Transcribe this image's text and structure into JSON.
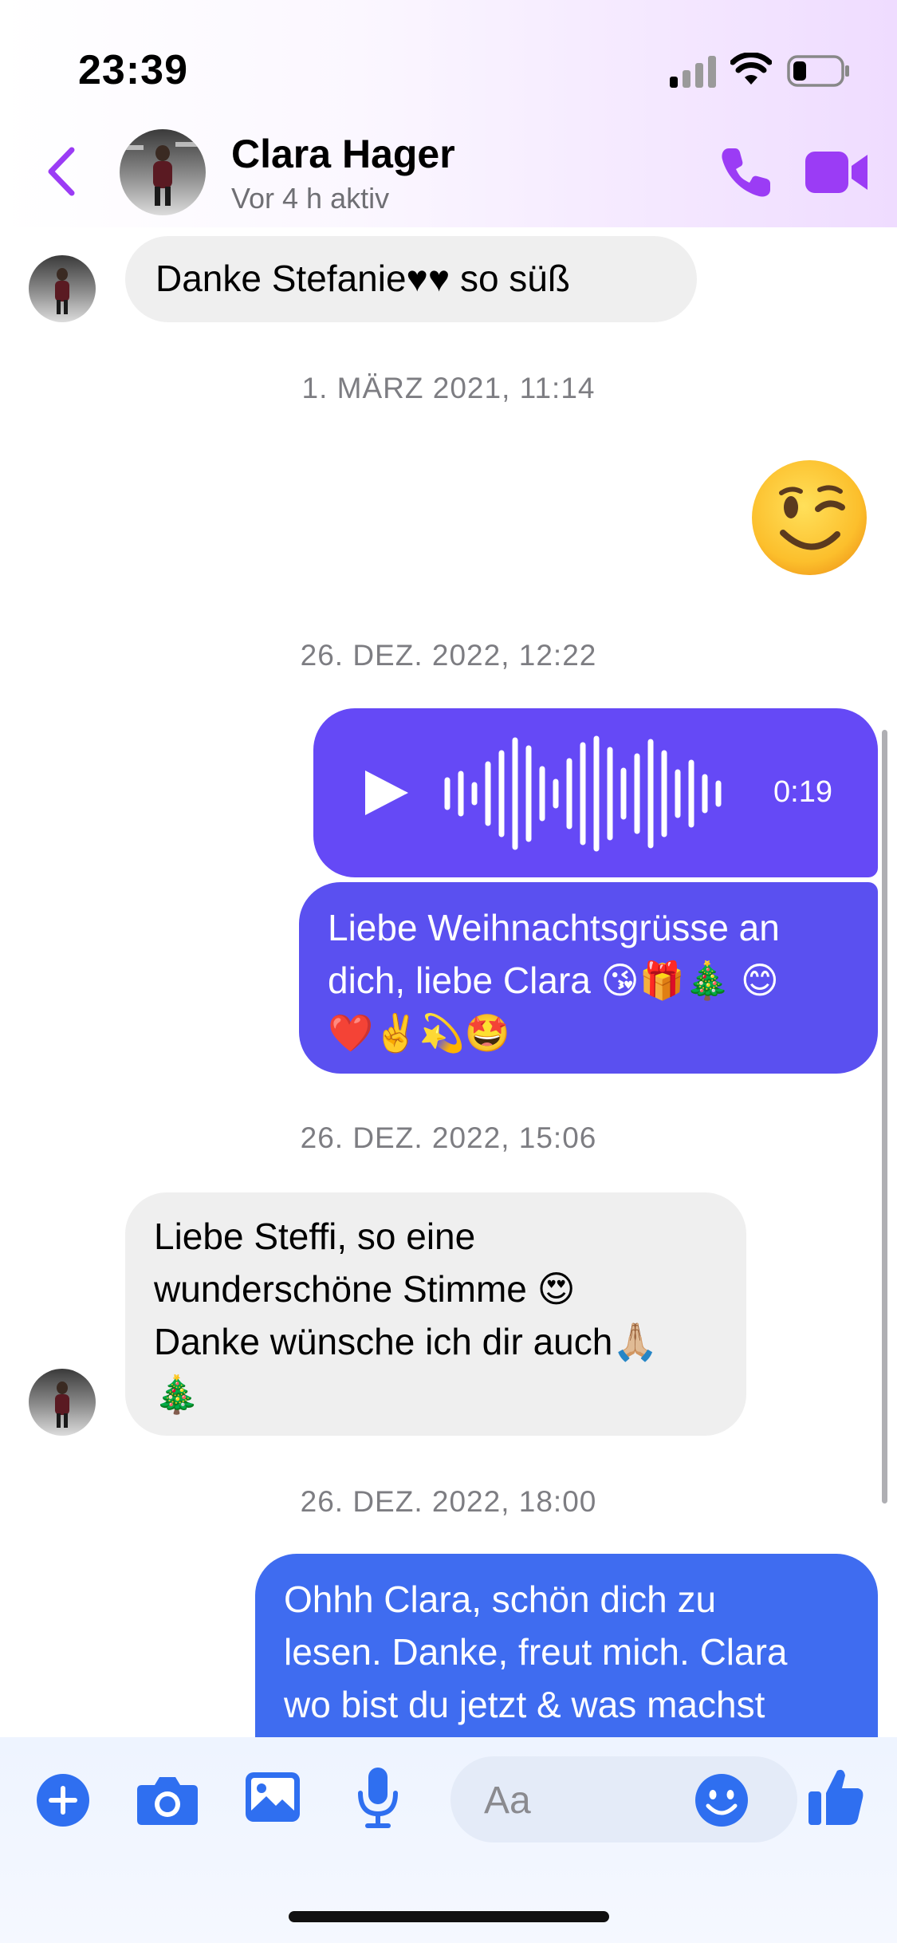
{
  "status_bar": {
    "time": "23:39"
  },
  "header": {
    "contact_name": "Clara Hager",
    "contact_status": "Vor 4 h aktiv",
    "icons": [
      "back-icon",
      "phone-icon",
      "video-camera-icon"
    ]
  },
  "messages": [
    {
      "type": "incoming_text",
      "text": "Danke Stefanie♥♥ so süß"
    },
    {
      "type": "timestamp",
      "text": "1. MÄRZ 2021, 11:14"
    },
    {
      "type": "outgoing_emoji",
      "emoji": "winking-face"
    },
    {
      "type": "timestamp",
      "text": "26. DEZ. 2022, 12:22"
    },
    {
      "type": "outgoing_voice",
      "duration": "0:19"
    },
    {
      "type": "outgoing_text",
      "text": "Liebe Weihnachtsgrüsse an dich, liebe Clara 😘🎁🎄 😊 ❤️✌️💫🤩"
    },
    {
      "type": "timestamp",
      "text": "26. DEZ. 2022, 15:06"
    },
    {
      "type": "incoming_text",
      "text": "Liebe Steffi, so eine wunderschöne Stimme 😍 Danke wünsche ich dir auch🙏🏼 🎄"
    },
    {
      "type": "timestamp",
      "text": "26. DEZ. 2022, 18:00"
    },
    {
      "type": "outgoing_text",
      "text": "Ohhh Clara, schön dich zu lesen. Danke, freut mich. Clara wo bist du jetzt & was machst"
    }
  ],
  "msg": {
    "m1_text": "Danke Stefanie♥♥ so süß",
    "ts1": "1. MÄRZ 2021, 11:14",
    "ts2": "26. DEZ. 2022, 12:22",
    "voice_duration": "0:19",
    "m3_line1": "Liebe Weihnachtsgrüsse an",
    "m3_line2": "dich, liebe Clara 😘🎁🎄 😊",
    "m3_line3": "❤️✌️💫🤩",
    "ts3": "26. DEZ. 2022, 15:06",
    "m4_line1": "Liebe Steffi, so eine",
    "m4_line2": "wunderschöne Stimme 😍",
    "m4_line3": "Danke wünsche ich dir auch🙏🏼",
    "m4_line4": "🎄",
    "ts4": "26. DEZ. 2022, 18:00",
    "m5_line1": "Ohhh Clara, schön dich zu",
    "m5_line2": "lesen. Danke, freut mich. Clara",
    "m5_line3": "wo bist du jetzt & was machst"
  },
  "composer": {
    "placeholder": "Aa",
    "icons": [
      "plus-icon",
      "camera-icon",
      "image-icon",
      "microphone-icon",
      "smiley-icon",
      "thumbs-up-icon"
    ]
  },
  "colors": {
    "accent_purple": "#9b3cf5",
    "voice_bubble": "#6549f6",
    "text_bubble_violet": "#5a50f0",
    "text_bubble_blue": "#3f6cf0",
    "incoming_bubble": "#efefef",
    "toolbar_blue": "#2f6ff0"
  }
}
